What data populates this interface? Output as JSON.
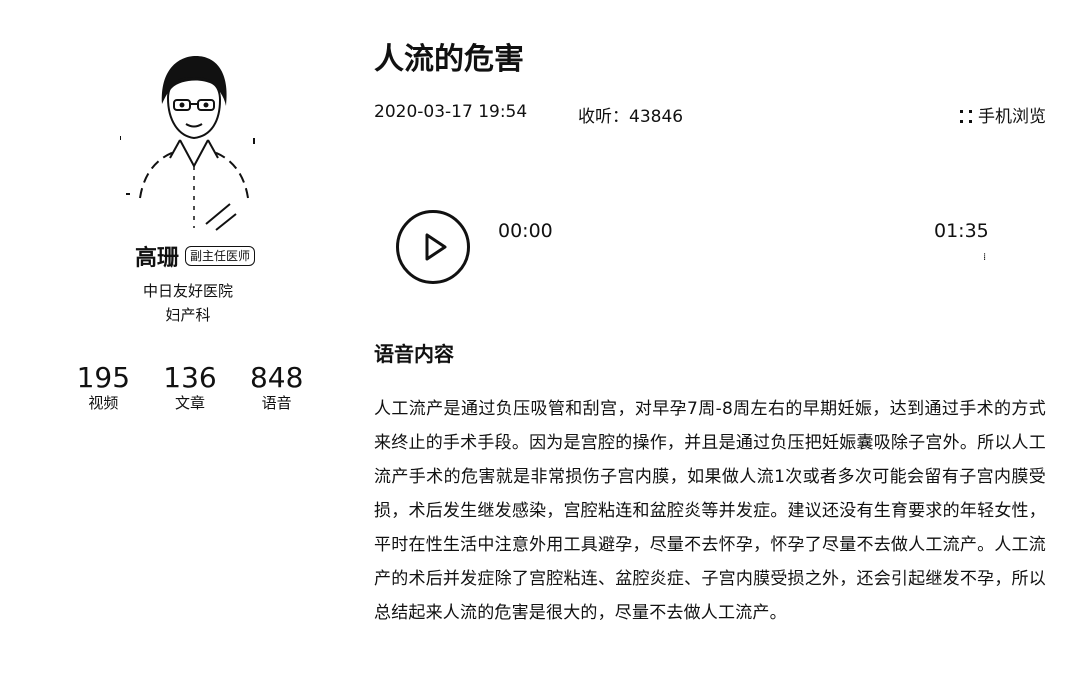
{
  "doctor": {
    "name": "高珊",
    "title_badge": "副主任医师",
    "hospital": "中日友好医院",
    "department": "妇产科",
    "stats": [
      {
        "value": "195",
        "label": "视频"
      },
      {
        "value": "136",
        "label": "文章"
      },
      {
        "value": "848",
        "label": "语音"
      }
    ]
  },
  "article": {
    "title": "人流的危害",
    "date": "2020-03-17 19:54",
    "listen_label": "收听：",
    "listen_count": "43846",
    "mobile_view": "手机浏览",
    "mobile_icon": "qr-code-icon"
  },
  "player": {
    "current_time": "00:00",
    "duration": "01:35",
    "play_icon": "play-icon"
  },
  "content": {
    "section_title": "语音内容",
    "body": "人工流产是通过负压吸管和刮宫，对早孕7周-8周左右的早期妊娠，达到通过手术的方式来终止的手术手段。因为是宫腔的操作，并且是通过负压把妊娠囊吸除子宫外。所以人工流产手术的危害就是非常损伤子宫内膜，如果做人流1次或者多次可能会留有子宫内膜受损，术后发生继发感染，宫腔粘连和盆腔炎等并发症。建议还没有生育要求的年轻女性，平时在性生活中注意外用工具避孕，尽量不去怀孕，怀孕了尽量不去做人工流产。人工流产的术后并发症除了宫腔粘连、盆腔炎症、子宫内膜受损之外，还会引起继发不孕，所以总结起来人流的危害是很大的，尽量不去做人工流产。"
  }
}
